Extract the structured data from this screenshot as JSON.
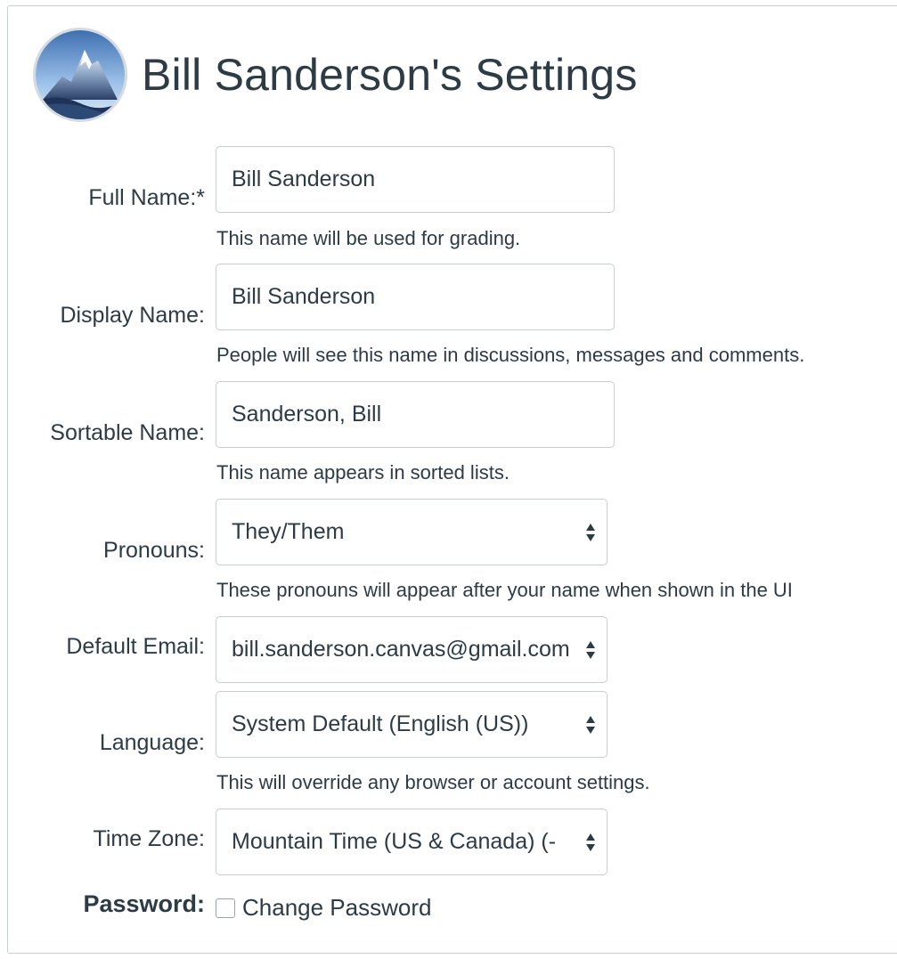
{
  "header": {
    "title": "Bill Sanderson's Settings"
  },
  "form": {
    "full_name": {
      "label": "Full Name:*",
      "value": "Bill Sanderson",
      "hint": "This name will be used for grading."
    },
    "display_name": {
      "label": "Display Name:",
      "value": "Bill Sanderson",
      "hint": "People will see this name in discussions, messages and comments."
    },
    "sortable_name": {
      "label": "Sortable Name:",
      "value": "Sanderson, Bill",
      "hint": "This name appears in sorted lists."
    },
    "pronouns": {
      "label": "Pronouns:",
      "selected": "They/Them",
      "hint": "These pronouns will appear after your name when shown in the UI"
    },
    "default_email": {
      "label": "Default Email:",
      "selected": "bill.sanderson.canvas@gmail.com"
    },
    "language": {
      "label": "Language:",
      "selected": "System Default (English (US))",
      "hint": "This will override any browser or account settings."
    },
    "time_zone": {
      "label": "Time Zone:",
      "selected": "Mountain Time (US & Canada) (-"
    },
    "password": {
      "label": "Password:",
      "checkbox_label": "Change Password",
      "checked": false
    }
  },
  "icons": {
    "avatar": "mountain-avatar-icon",
    "select_arrows": "chevron-up-down-icon"
  },
  "colors": {
    "text": "#2d3b45",
    "border": "#c7cdd1"
  }
}
